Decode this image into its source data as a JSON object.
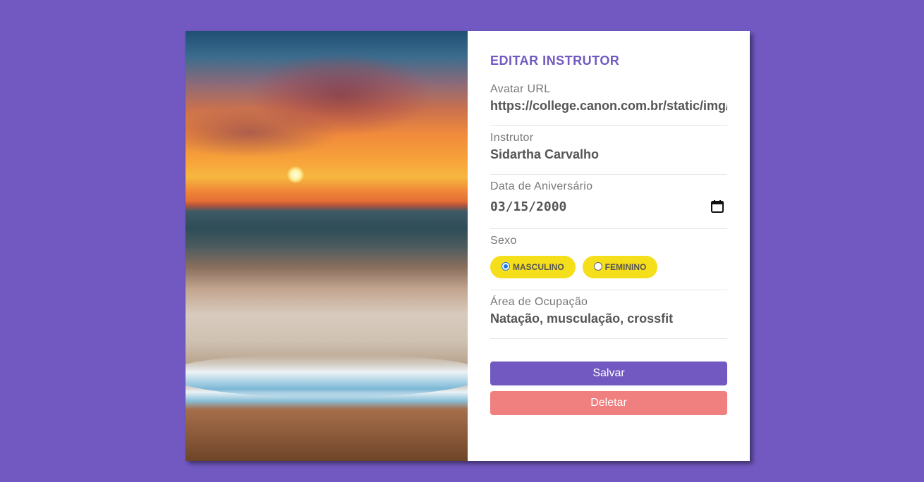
{
  "form": {
    "title": "EDITAR INSTRUTOR",
    "avatar": {
      "label": "Avatar URL",
      "value": "https://college.canon.com.br/static/img/"
    },
    "name": {
      "label": "Instrutor",
      "value": "Sidartha Carvalho"
    },
    "birth": {
      "label": "Data de Aniversário",
      "value": "03/15/2000",
      "icon": "calendar-icon"
    },
    "gender": {
      "label": "Sexo",
      "options": [
        {
          "label": "MASCULINO",
          "checked": true
        },
        {
          "label": "FEMININO",
          "checked": false
        }
      ]
    },
    "services": {
      "label": "Área de Ocupação",
      "value": "Natação, musculação, crossfit"
    }
  },
  "buttons": {
    "save": "Salvar",
    "delete": "Deletar"
  },
  "colors": {
    "background": "#7159c1",
    "accent": "#7159c1",
    "radio_pill": "#f5de1a",
    "delete": "#f07f7f"
  }
}
